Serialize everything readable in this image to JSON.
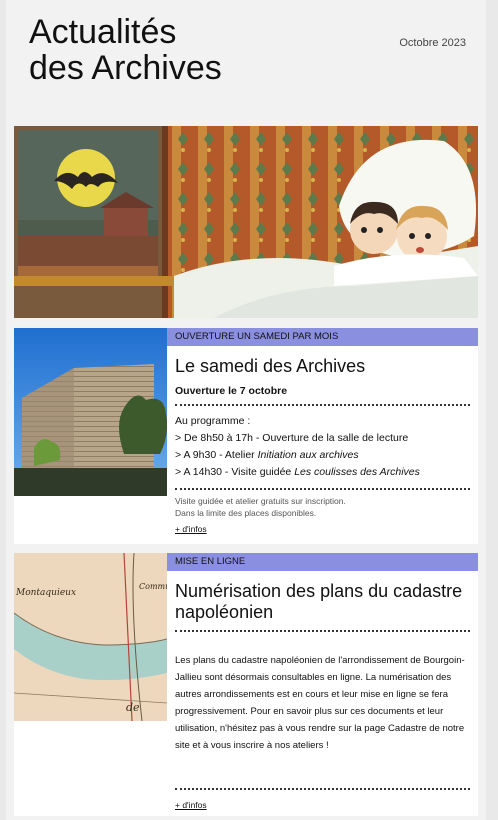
{
  "header": {
    "title_line1": "Actualités",
    "title_line2": "des Archives",
    "date": "Octobre 2023"
  },
  "article1": {
    "tag": "OUVERTURE UN SAMEDI PAR MOIS",
    "title": "Le samedi des Archives",
    "subtitle": "Ouverture le 7 octobre",
    "program_intro": "Au programme :",
    "items": [
      {
        "text": "> De 8h50 à 17h - Ouverture de la salle de lecture",
        "em": ""
      },
      {
        "text": "> A 9h30 - Atelier ",
        "em": "Initiation aux archives"
      },
      {
        "text": "> A 14h30 - Visite guidée ",
        "em": "Les coulisses des Archives"
      }
    ],
    "note_line1": "Visite guidée et atelier gratuits sur inscription.",
    "note_line2": "Dans la limite des places disponibles.",
    "more": "+ d'infos"
  },
  "article2": {
    "tag": "MISE EN LIGNE",
    "title": "Numérisation des plans du cadastre napoléonien",
    "body": "Les plans du cadastre napoléonien de l'arrondissement de Bourgoin-Jallieu sont désormais consultables en ligne. La numérisation des autres arrondissements est en cours et leur mise en ligne se fera progressivement. Pour en savoir plus sur ces documents et leur utilisation, n'hésitez pas à vous rendre sur la page Cadastre de notre site et à vous inscrire à nos ateliers !",
    "more": "+ d'infos",
    "map_label1": "Montaquieux",
    "map_label2": "Commu",
    "map_label3": "de"
  },
  "colors": {
    "tag_bg": "#8b8fe0",
    "page_bg": "#f2f2f2"
  }
}
